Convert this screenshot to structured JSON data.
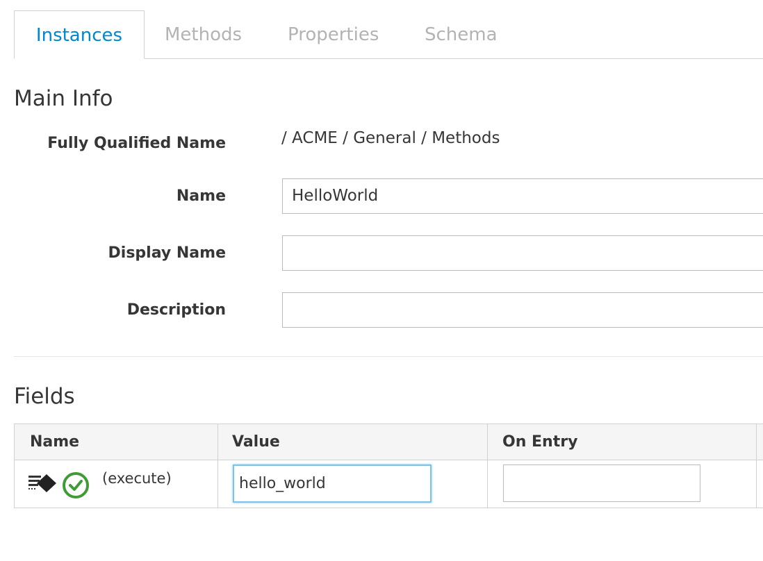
{
  "tabs": [
    {
      "label": "Instances",
      "active": true
    },
    {
      "label": "Methods",
      "active": false
    },
    {
      "label": "Properties",
      "active": false
    },
    {
      "label": "Schema",
      "active": false
    }
  ],
  "main_info": {
    "title": "Main Info",
    "fqn_label": "Fully Qualified Name",
    "fqn_value": "/ ACME / General / Methods",
    "name_label": "Name",
    "name_value": "HelloWorld",
    "display_name_label": "Display Name",
    "display_name_value": "",
    "description_label": "Description",
    "description_value": ""
  },
  "fields": {
    "title": "Fields",
    "columns": [
      "Name",
      "Value",
      "On Entry"
    ],
    "rows": [
      {
        "icons": [
          "method-icon",
          "check-circle-icon"
        ],
        "name": "(execute)",
        "value": "hello_world",
        "on_entry": ""
      }
    ]
  },
  "colors": {
    "accent": "#0088ce",
    "inactive_tab": "#b3b3b3",
    "success": "#3f9c35",
    "border": "#bbbbbb"
  }
}
